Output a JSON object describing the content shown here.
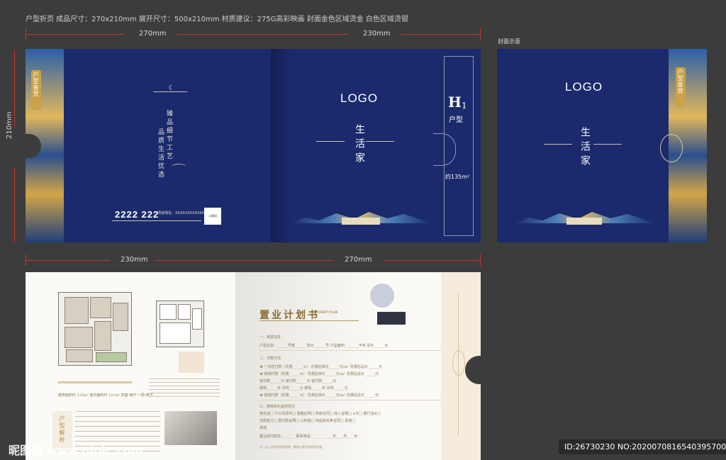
{
  "spec_line": "户型折页 成品尺寸：270x210mm 展开尺寸：500x210mm 材质建议：275G高彩映画   封面金色区域烫金 白色区域烫银",
  "dimensions": {
    "top_left": "270mm",
    "top_right": "230mm",
    "left_height": "210mm",
    "mid_left": "230mm",
    "mid_right": "270mm"
  },
  "cover_preview_label": "封面示意",
  "outer_spread": {
    "seal_text": "户型鉴赏",
    "vertical_lines": [
      "臻品细节工艺",
      "品质生活优选"
    ],
    "phone": "2222 222",
    "address": "项目地址：XXXXXXXXXXXXXX",
    "qr_label": "二维码",
    "logo": "LOGO",
    "title": "生活家",
    "h1_letter": "H",
    "h1_number": "1",
    "h1_type": "户型",
    "area": "约135m²"
  },
  "cover_preview": {
    "logo": "LOGO",
    "title": "生活家",
    "seal_text": "户型鉴赏"
  },
  "inner_spread": {
    "area_line": "建筑面积约 135m² 套内面积约 101m² 四室·两厅·一厨·两卫",
    "type_tag": "户型解析",
    "plan_heading": "置业计划书",
    "plan_heading_en": "PROPERTY PLAN",
    "sections": [
      "一、房屋信息",
      "二、付款方式",
      "三、按揭资料提供情况"
    ],
    "row_house": "户型信息：______号楼 ______单元 ______号     户型面积：______平米     总价______元",
    "row_pay1": "★·一次性付款（优惠______%）          优惠后单价______元/m²     优惠后总价______元",
    "row_pay2": "★·按揭付款（优惠______%）            优惠后单价______元/m²     优惠后总价______元",
    "row_pay3": "首付款______元    首付款______元    首付款______元",
    "row_pay4": "按揭______年    月供______元    按揭______年    月供______元",
    "row_pay5": "★·按揭付款（优惠______%）            优惠后单价______元/m²     优惠后总价______元",
    "row_docs1": "身份证□   户口本原件□   婚姻证明□   购房合同□   收入证明□   A卡□   银行流水□",
    "row_docs2": "还款能力□   首付款证明□   公积金□   商品房买卖合同□   其他□",
    "row_other": "其他",
    "row_sign": "置业顾问签名：______     联系电话：______          ____年____月____日",
    "footer_note": "注：以上计划书仅供参考，最终以签订的合同为准。"
  },
  "watermark": "昵图网 www.nipic.com",
  "image_id": "ID:26730230 NO:20200708165403957000"
}
